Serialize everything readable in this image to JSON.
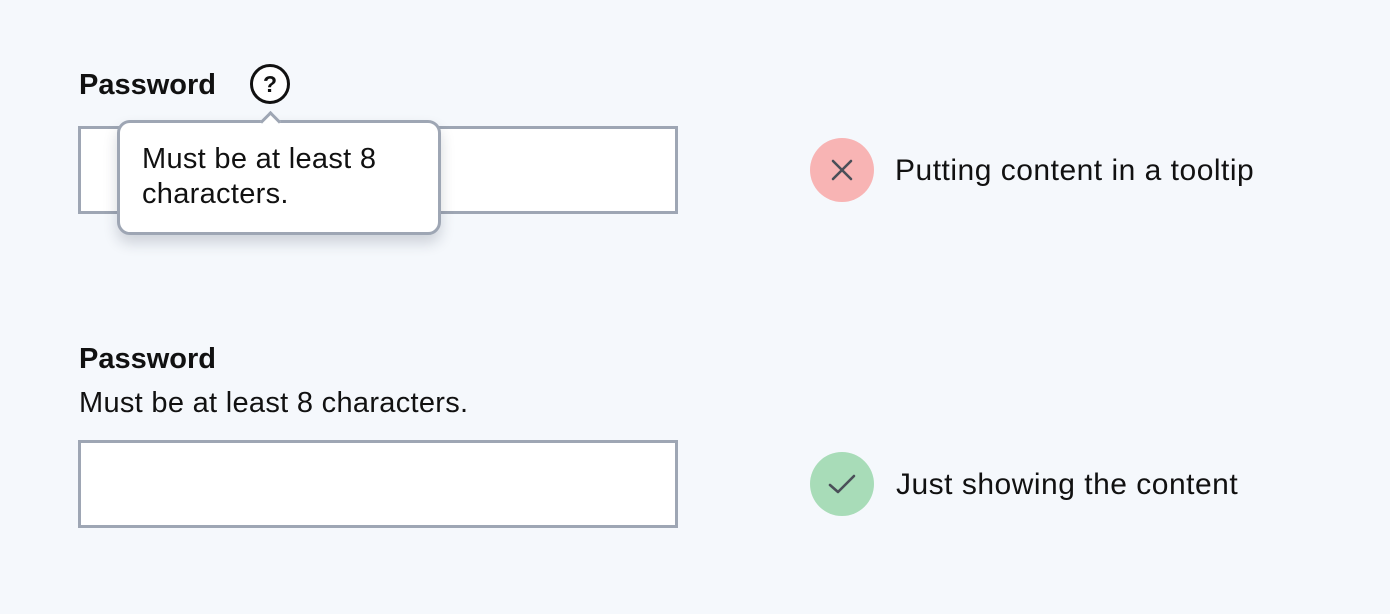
{
  "examples": {
    "tooltip": {
      "field_label": "Password",
      "help_icon": "question-circle-icon",
      "help_glyph": "?",
      "tooltip_text": "Must be at least 8 characters.",
      "input_value": "",
      "verdict_icon": "x-icon",
      "verdict_color": "#f8b4b4",
      "verdict_text": "Putting content in a tooltip"
    },
    "inline": {
      "field_label": "Password",
      "hint_text": "Must be at least 8 characters.",
      "input_value": "",
      "verdict_icon": "checkmark-icon",
      "verdict_color": "#a8dcb8",
      "verdict_text": "Just showing the content"
    }
  },
  "colors": {
    "background": "#f5f8fc",
    "input_border": "#9ea6b4",
    "icon_stroke": "#4a4f58"
  }
}
